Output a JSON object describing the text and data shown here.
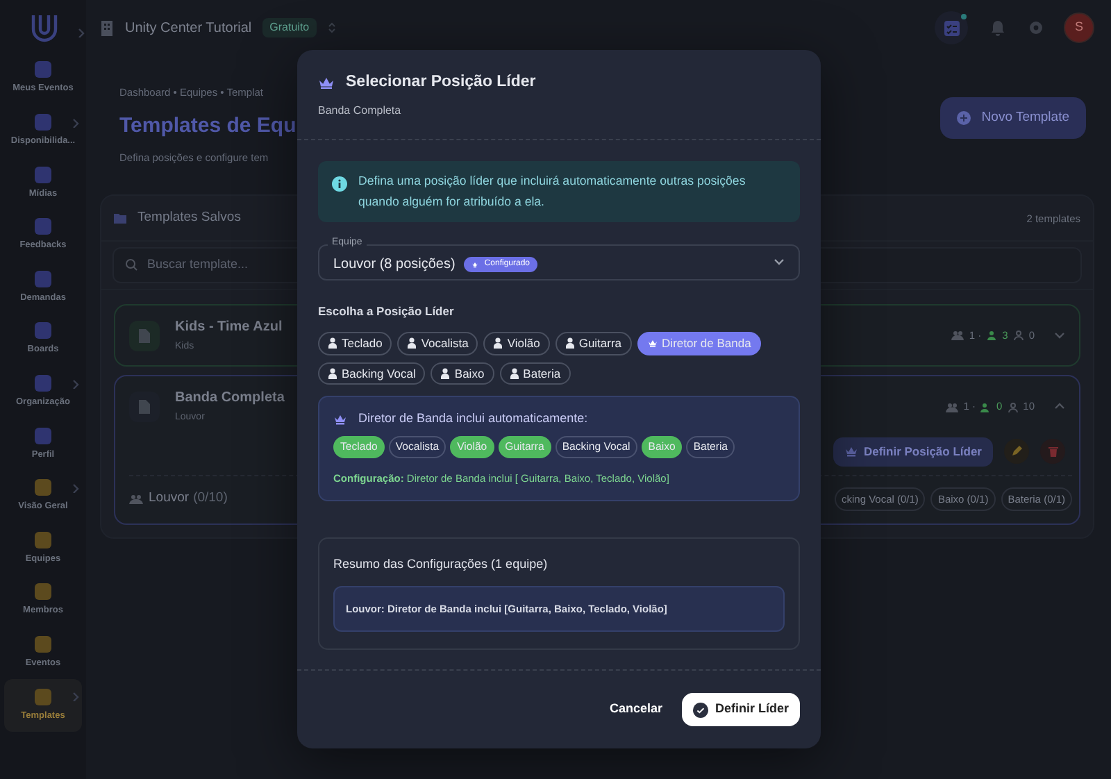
{
  "sidebar": {
    "items": [
      {
        "label": "Meus Eventos",
        "color": "#2f3470",
        "has_submenu": false,
        "selected": false
      },
      {
        "label": "Disponibilida...",
        "color": "#2f3470",
        "has_submenu": true,
        "selected": false
      },
      {
        "label": "Mídias",
        "color": "#2f3470",
        "has_submenu": false,
        "selected": false
      },
      {
        "label": "Feedbacks",
        "color": "#2f3470",
        "has_submenu": false,
        "selected": false
      },
      {
        "label": "Demandas",
        "color": "#2f3470",
        "has_submenu": false,
        "selected": false
      },
      {
        "label": "Boards",
        "color": "#2f3470",
        "has_submenu": false,
        "selected": false
      },
      {
        "label": "Organização",
        "color": "#2f3470",
        "has_submenu": true,
        "selected": false
      },
      {
        "label": "Perfil",
        "color": "#2f3470",
        "has_submenu": false,
        "selected": false
      },
      {
        "label": "Visão Geral",
        "color": "#5c4a1e",
        "has_submenu": true,
        "selected": false
      },
      {
        "label": "Equipes",
        "color": "#5c4a1e",
        "has_submenu": false,
        "selected": false
      },
      {
        "label": "Membros",
        "color": "#5c4a1e",
        "has_submenu": false,
        "selected": false
      },
      {
        "label": "Eventos",
        "color": "#5c4a1e",
        "has_submenu": false,
        "selected": false
      },
      {
        "label": "Templates",
        "color": "#5c4a1e",
        "has_submenu": true,
        "selected": true
      }
    ]
  },
  "topbar": {
    "org_name": "Unity Center Tutorial",
    "plan_badge": "Gratuito",
    "avatar_initial": "S"
  },
  "page": {
    "breadcrumb": "Dashboard • Equipes • Templat",
    "title": "Templates de Equ",
    "subtitle": "Defina posições e configure tem",
    "new_button": "Novo Template"
  },
  "templates_card": {
    "title": "Templates Salvos",
    "count": "2 templates",
    "search": {
      "placeholder": "Buscar template..."
    },
    "templates": [
      {
        "name": "Kids - Time Azul",
        "team": "Kids",
        "expanded": false,
        "stats": {
          "teams": "1 ·",
          "filled": "3",
          "open": "0"
        }
      },
      {
        "name": "Banda Completa",
        "team": "Louvor",
        "expanded": true,
        "stats": {
          "teams": "1 ·",
          "filled": "0",
          "open": "10"
        },
        "leader_button": "Definir Posição Líder",
        "team_row": {
          "name": "Louvor",
          "count": "(0/10)",
          "positions": [
            "cking Vocal (0/1)",
            "Baixo (0/1)",
            "Bateria (0/1)"
          ]
        }
      }
    ]
  },
  "modal": {
    "title": "Selecionar Posição Líder",
    "subtitle": "Banda Completa",
    "info": "Defina uma posição líder que incluirá automaticamente outras posições quando alguém for atribuído a ela.",
    "team_select": {
      "label": "Equipe",
      "value": "Louvor (8 posições)",
      "badge": "Configurado"
    },
    "positions_heading": "Escolha a Posição Líder",
    "positions": [
      {
        "label": "Teclado",
        "selected": false
      },
      {
        "label": "Vocalista",
        "selected": false
      },
      {
        "label": "Violão",
        "selected": false
      },
      {
        "label": "Guitarra",
        "selected": false
      },
      {
        "label": "Diretor de Banda",
        "selected": true
      },
      {
        "label": "Backing Vocal",
        "selected": false
      },
      {
        "label": "Baixo",
        "selected": false
      },
      {
        "label": "Bateria",
        "selected": false
      }
    ],
    "includes": {
      "title": "Diretor de Banda inclui automaticamente:",
      "positions": [
        {
          "label": "Teclado",
          "included": true
        },
        {
          "label": "Vocalista",
          "included": false
        },
        {
          "label": "Violão",
          "included": true
        },
        {
          "label": "Guitarra",
          "included": true
        },
        {
          "label": "Backing Vocal",
          "included": false
        },
        {
          "label": "Baixo",
          "included": true
        },
        {
          "label": "Bateria",
          "included": false
        }
      ],
      "config": "**Configuração:** Diretor de Banda inclui [ Guitarra, Baixo, Teclado, Violão]"
    },
    "summary": {
      "title": "Resumo das Configurações (1 equipe)",
      "entries": [
        "Louvor: Diretor de Banda inclui [Guitarra, Baixo, Teclado, Violão]"
      ]
    },
    "buttons": {
      "cancel": "Cancelar",
      "confirm": "Definir Líder"
    }
  }
}
